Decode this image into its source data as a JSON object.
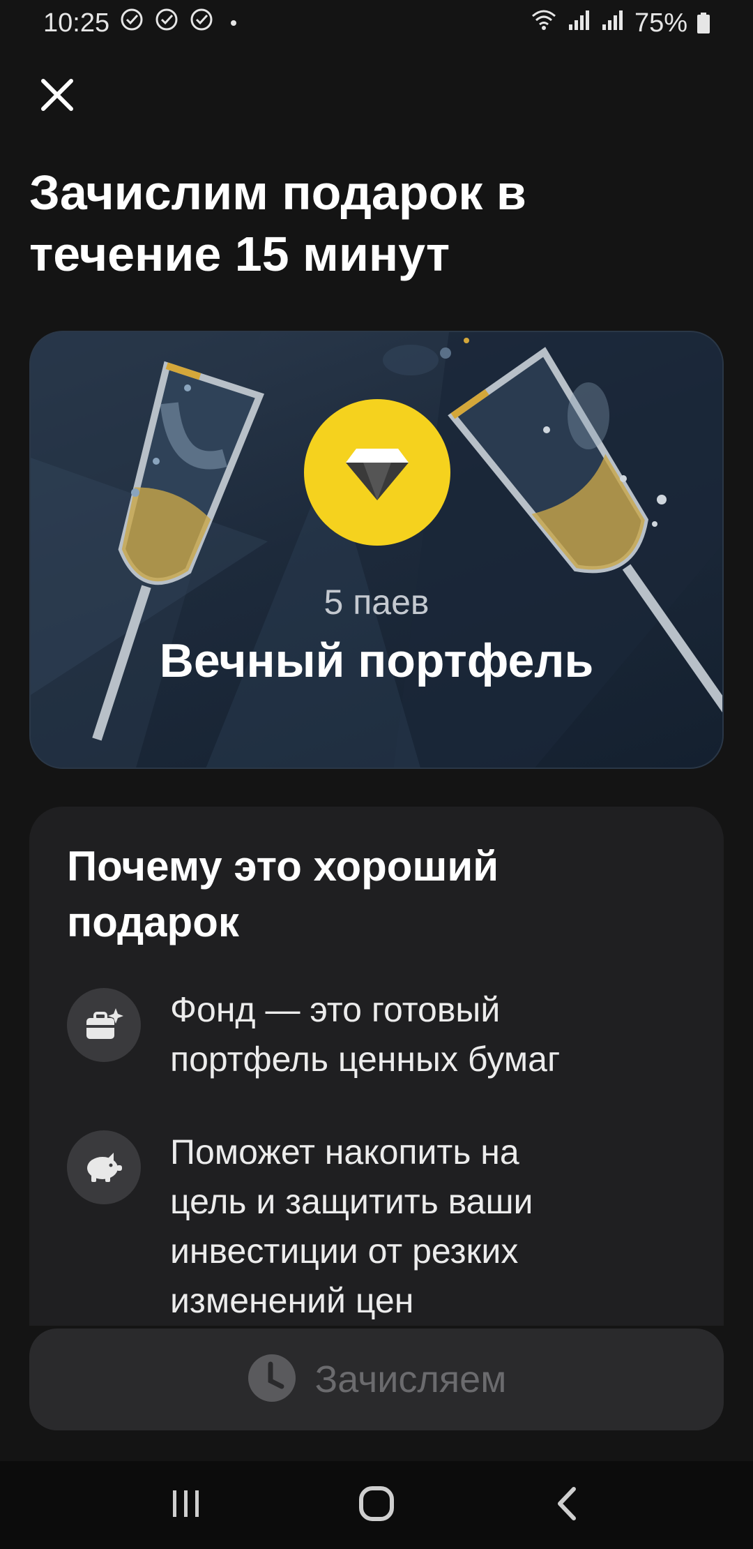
{
  "status_bar": {
    "time": "10:25",
    "battery": "75%",
    "icons": [
      "check-circle-icon",
      "check-circle-icon",
      "check-circle-icon",
      "wifi-icon",
      "signal-icon",
      "signal-icon",
      "battery-icon"
    ]
  },
  "header": {
    "title": "Зачислим подарок в\nтечение 15 минут"
  },
  "gift": {
    "amount": "5 паев",
    "name": "Вечный портфель",
    "logo_color": "#f5d21e"
  },
  "reasons": {
    "title": "Почему это хороший\nподарок",
    "items": [
      {
        "icon": "briefcase-sparkle-icon",
        "text": "Фонд — это готовый\nпортфель ценных бумаг"
      },
      {
        "icon": "piggy-bank-icon",
        "text": "Поможет накопить на\nцель и защитить ваши\nинвестиции от резких\nизменений цен"
      }
    ]
  },
  "action": {
    "label": "Зачисляем",
    "icon": "clock-icon",
    "state": "disabled"
  },
  "navigation": {
    "buttons": [
      "recent-apps-icon",
      "home-icon",
      "back-icon"
    ]
  },
  "colors": {
    "background": "#141414",
    "card": "#1f1f21",
    "accent": "#f5d21e",
    "button_disabled": "#2a2a2c"
  }
}
